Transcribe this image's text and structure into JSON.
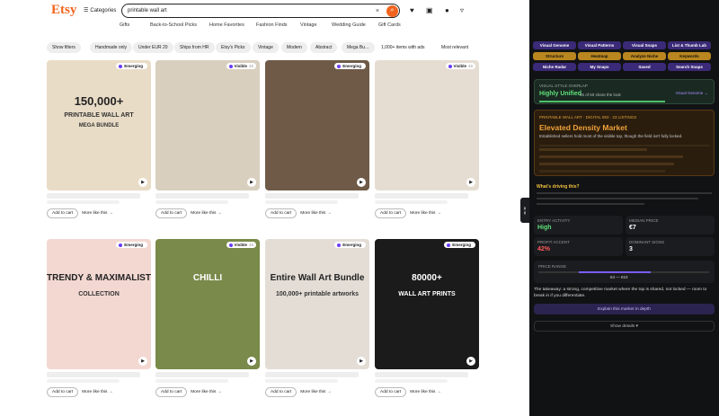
{
  "header": {
    "logo": "Etsy",
    "categories": "Categories",
    "search_value": "printable wall art",
    "clear": "×",
    "go": "⌕"
  },
  "subnav": [
    "Gifts",
    "Back-to-School Picks",
    "Home Favorites",
    "Fashion Finds",
    "Vintage",
    "Wedding Guide",
    "Gift Cards"
  ],
  "filters": [
    "Show filters",
    "Handmade only",
    "Under EUR 20",
    "Ships from HR",
    "Etsy's Picks",
    "Vintage",
    "Modern",
    "Abstract",
    "Mega Bu…"
  ],
  "results": "1,000+ items with ads",
  "sort": "Most relevant",
  "add_label": "Add to cart",
  "more_label": "More like this →",
  "cards": [
    {
      "badge": "Emerging",
      "badge_num": "",
      "title": "150,000+",
      "sub": "PRINTABLE WALL ART",
      "sub2": "MEGA BUNDLE",
      "bg": "#e9dcc6"
    },
    {
      "badge": "Visible",
      "badge_num": "48",
      "title": "",
      "sub": "",
      "sub2": "",
      "bg": "#d8cfbf"
    },
    {
      "badge": "Emerging",
      "badge_num": "",
      "title": "",
      "sub": "",
      "sub2": "",
      "bg": "#6e5a47"
    },
    {
      "badge": "Visible",
      "badge_num": "48",
      "title": "",
      "sub": "",
      "sub2": "",
      "bg": "#e6ddd2"
    },
    {
      "badge": "Emerging",
      "badge_num": "",
      "title": "TRENDY & MAXIMALIST",
      "sub": "COLLECTION",
      "sub2": "",
      "bg": "#f3d8d2"
    },
    {
      "badge": "Visible",
      "badge_num": "48",
      "title": "CHILLI",
      "sub": "",
      "sub2": "",
      "bg": "#7a8a4a"
    },
    {
      "badge": "Emerging",
      "badge_num": "",
      "title": "Entire Wall Art Bundle",
      "sub": "100,000+ printable artworks",
      "sub2": "",
      "bg": "#e3ddd6"
    },
    {
      "badge": "Emerging",
      "badge_num": "",
      "title": "80000+",
      "sub": "WALL ART PRINTS",
      "sub2": "",
      "bg": "#1b1b1b"
    }
  ],
  "panel": {
    "tabs_row1": [
      "Visual Genome",
      "Visual Patterns",
      "Visual Snaps",
      "List & Thumb Lab"
    ],
    "tabs_row2": [
      "Structure",
      "Heatmap",
      "Analyze Niche",
      "Keywords"
    ],
    "tabs_row3": [
      "Niche Radar",
      "My Snaps",
      "Saved",
      "Search Snaps"
    ],
    "overlap_label": "VISUAL STYLE OVERLAP",
    "overlap_value": "Highly Unified",
    "overlap_sub": "45 of 60 share the look",
    "overlap_link": "Visual Genome →",
    "market_tag": "PRINTABLE WALL ART · DIGITAL 050 · 23 LISTINGS",
    "market_title": "Elevated Density Market",
    "market_desc": "Established sellers hold most of the visible top, though the field isn't fully locked.",
    "driving": "What's driving this?",
    "stats": [
      {
        "label": "ENTRY ACTIVITY",
        "value": "High"
      },
      {
        "label": "MEDIAN PRICE",
        "value": "€7"
      },
      {
        "label": "PROFIT ACCENT",
        "value": "42%"
      },
      {
        "label": "DOMINANT SIGNS",
        "value": "3"
      }
    ],
    "price_label": "PRICE RANGE",
    "price_range": "€4 — €10",
    "takeaway": "The takeaway: a strong, competitive market where the top is shared, not locked — room to break in if you differentiate.",
    "explain": "Explain this market in depth",
    "details": "Show details ▾",
    "accent": "#f1641e",
    "violet": "#3a2a78",
    "gold": "#b9861f"
  }
}
